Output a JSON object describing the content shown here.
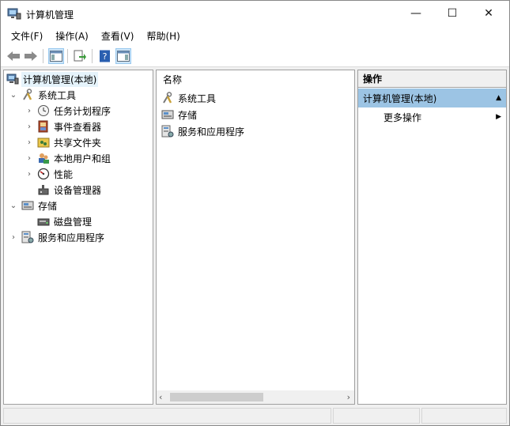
{
  "window": {
    "title": "计算机管理",
    "minimize_glyph": "—",
    "maximize_glyph": "☐",
    "close_glyph": "✕"
  },
  "menu": [
    "文件(F)",
    "操作(A)",
    "查看(V)",
    "帮助(H)"
  ],
  "toolbar": {
    "buttons": [
      "back-icon",
      "forward-icon",
      "show-hide-tree-icon",
      "export-list-icon",
      "help-icon",
      "show-hide-action-pane-icon"
    ]
  },
  "tree": {
    "root": "计算机管理(本地)",
    "system_tools": "系统工具",
    "task_scheduler": "任务计划程序",
    "event_viewer": "事件查看器",
    "shared_folders": "共享文件夹",
    "local_users_groups": "本地用户和组",
    "performance": "性能",
    "device_manager": "设备管理器",
    "storage": "存储",
    "disk_management": "磁盘管理",
    "services_apps": "服务和应用程序"
  },
  "list": {
    "column_name": "名称",
    "items": [
      "系统工具",
      "存储",
      "服务和应用程序"
    ]
  },
  "actions": {
    "header": "操作",
    "group": "计算机管理(本地)",
    "more": "更多操作"
  },
  "colors": {
    "selection": "#e5f3fb",
    "actions_group_bg": "#9cc4e4"
  }
}
